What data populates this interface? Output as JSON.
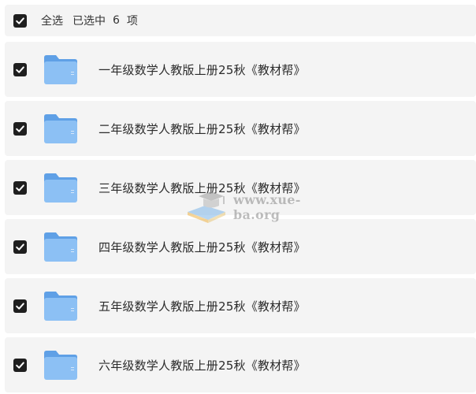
{
  "selection_bar": {
    "select_all_label": "全选",
    "selected_prefix": "已选中",
    "selected_count": "6",
    "selected_suffix": "项",
    "checked": true
  },
  "files": [
    {
      "name": "一年级数学人教版上册25秋《教材帮》",
      "type": "folder",
      "checked": true,
      "icon": "folder-icon"
    },
    {
      "name": "二年级数学人教版上册25秋《教材帮》",
      "type": "folder",
      "checked": true,
      "icon": "folder-icon"
    },
    {
      "name": "三年级数学人教版上册25秋《教材帮》",
      "type": "folder",
      "checked": true,
      "icon": "folder-icon"
    },
    {
      "name": "四年级数学人教版上册25秋《教材帮》",
      "type": "folder",
      "checked": true,
      "icon": "folder-icon"
    },
    {
      "name": "五年级数学人教版上册25秋《教材帮》",
      "type": "folder",
      "checked": true,
      "icon": "folder-icon"
    },
    {
      "name": "六年级数学人教版上册25秋《教材帮》",
      "type": "folder",
      "checked": true,
      "icon": "folder-icon"
    }
  ],
  "watermark": {
    "text": "www.xue-ba.org",
    "icon": "graduation-cap-book-logo"
  },
  "colors": {
    "row_background": "#f4f4f4",
    "checkbox_fill": "#1f1f1f",
    "folder_blue": "#7fb6f0",
    "text": "#2b2b2b"
  }
}
